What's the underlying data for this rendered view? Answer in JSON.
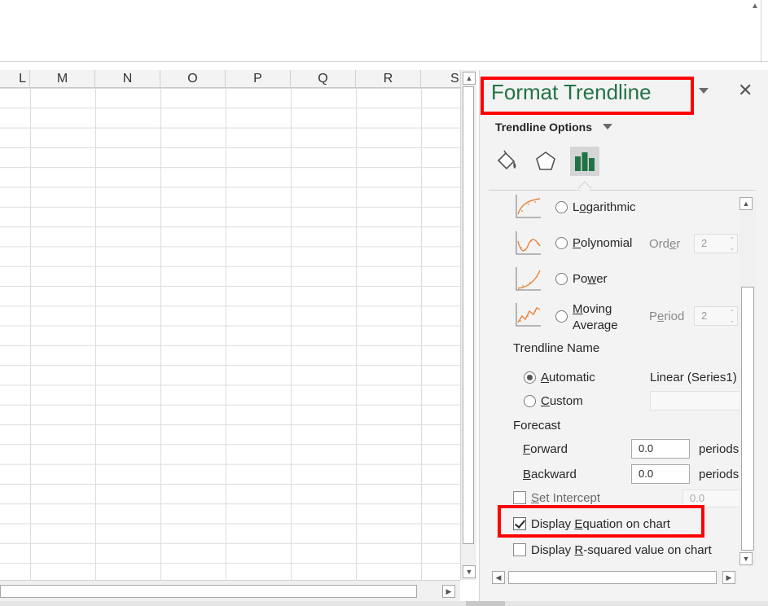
{
  "columns": [
    "L",
    "M",
    "N",
    "O",
    "P",
    "Q",
    "R",
    "S"
  ],
  "pane": {
    "title": "Format Trendline",
    "options_label": "Trendline Options",
    "tabs": [
      {
        "name": "Fill & Line",
        "icon": "paint-bucket-icon"
      },
      {
        "name": "Effects",
        "icon": "pentagon-icon"
      },
      {
        "name": "Trendline Options",
        "icon": "bar-chart-icon",
        "active": true
      }
    ]
  },
  "trend_types": [
    {
      "pre": "L",
      "u": "o",
      "post": "garithmic",
      "checked": false
    },
    {
      "pre": "",
      "u": "P",
      "post": "olynomial",
      "checked": false,
      "param_pre": "Ord",
      "param_u": "e",
      "param_post": "r",
      "param_value": "2"
    },
    {
      "pre": "Po",
      "u": "w",
      "post": "er",
      "checked": false
    },
    {
      "pre": "",
      "u": "M",
      "post": "oving",
      "line2": "Average",
      "checked": false,
      "param_pre": "P",
      "param_u": "e",
      "param_post": "riod",
      "param_value": "2"
    }
  ],
  "trendline_name": {
    "heading": "Trendline Name",
    "automatic_pre": "",
    "automatic_u": "A",
    "automatic_post": "utomatic",
    "automatic_value": "Linear (Series1)",
    "custom_pre": "",
    "custom_u": "C",
    "custom_post": "ustom",
    "custom_value": ""
  },
  "forecast": {
    "heading": "Forecast",
    "forward_pre": "",
    "forward_u": "F",
    "forward_post": "orward",
    "forward_value": "0.0",
    "backward_pre": "",
    "backward_u": "B",
    "backward_post": "ackward",
    "backward_value": "0.0",
    "unit": "periods"
  },
  "set_intercept": {
    "pre": "",
    "u": "S",
    "post": "et Intercept",
    "checked": false,
    "value": "0.0"
  },
  "display_equation": {
    "pre": "Display ",
    "u": "E",
    "post": "quation on chart",
    "checked": true
  },
  "display_rsquared": {
    "pre": "Display ",
    "u": "R",
    "post": "-squared value on chart",
    "checked": false
  },
  "colors": {
    "accent": "#217346",
    "highlight": "#ff0000",
    "trend_curve": "#e8833a"
  }
}
